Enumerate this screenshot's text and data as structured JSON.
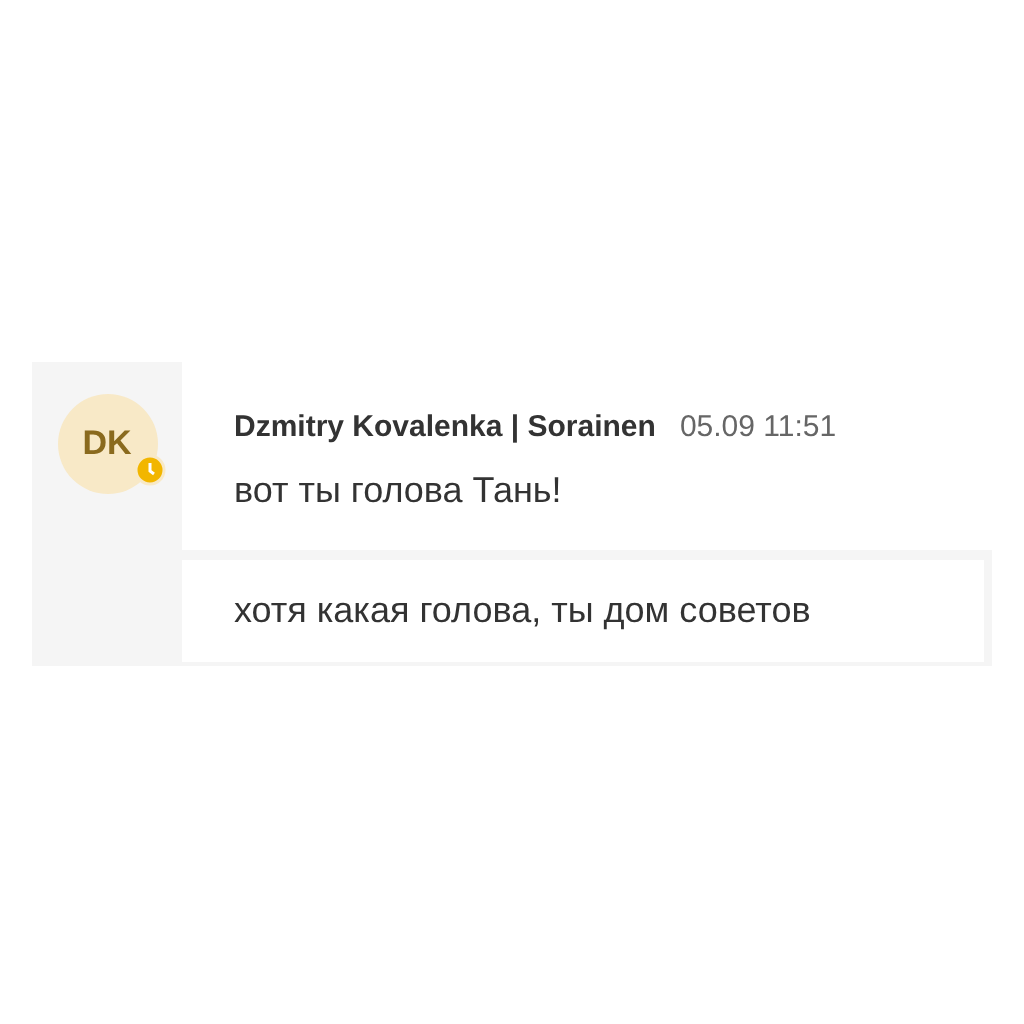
{
  "message_group": {
    "avatar": {
      "initials": "DK",
      "away": true
    },
    "author": "Dzmitry Kovalenka | Sorainen",
    "time": "05.09 11:51",
    "messages": [
      {
        "text": "вот ты голова Тань!"
      },
      {
        "text": "хотя какая голова, ты дом советов"
      }
    ]
  }
}
